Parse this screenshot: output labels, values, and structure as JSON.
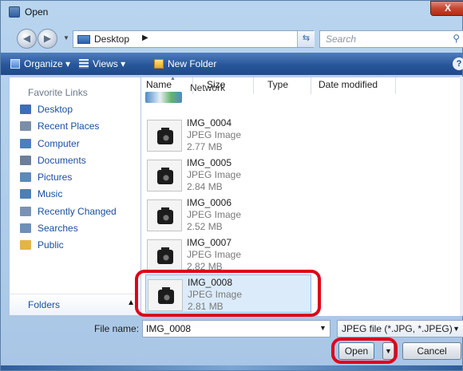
{
  "window": {
    "title": "Open",
    "close_label": "X"
  },
  "address": {
    "location": "Desktop",
    "search_placeholder": "Search"
  },
  "toolbar": {
    "organize": "Organize",
    "views": "Views",
    "new_folder": "New Folder",
    "help": "?"
  },
  "sidebar": {
    "heading": "Favorite Links",
    "items": [
      {
        "label": "Desktop",
        "icon": "desktop-icon",
        "color": "#3d6eb7"
      },
      {
        "label": "Recent Places",
        "icon": "recent-places-icon",
        "color": "#7b8ea8"
      },
      {
        "label": "Computer",
        "icon": "computer-icon",
        "color": "#4a7fc4"
      },
      {
        "label": "Documents",
        "icon": "documents-icon",
        "color": "#6c7f99"
      },
      {
        "label": "Pictures",
        "icon": "pictures-icon",
        "color": "#5d89b8"
      },
      {
        "label": "Music",
        "icon": "music-icon",
        "color": "#4f7fb7"
      },
      {
        "label": "Recently Changed",
        "icon": "recently-changed-icon",
        "color": "#7a93b4"
      },
      {
        "label": "Searches",
        "icon": "searches-icon",
        "color": "#6f8fb8"
      },
      {
        "label": "Public",
        "icon": "public-folder-icon",
        "color": "#e3b44a"
      }
    ],
    "folders_label": "Folders"
  },
  "columns": [
    "Name",
    "Size",
    "Type",
    "Date modified"
  ],
  "files": [
    {
      "name": "Network",
      "partial": true
    },
    {
      "name": "IMG_0004",
      "type": "JPEG Image",
      "size": "2.77 MB"
    },
    {
      "name": "IMG_0005",
      "type": "JPEG Image",
      "size": "2.84 MB"
    },
    {
      "name": "IMG_0006",
      "type": "JPEG Image",
      "size": "2.52 MB"
    },
    {
      "name": "IMG_0007",
      "type": "JPEG Image",
      "size": "2.82 MB"
    },
    {
      "name": "IMG_0008",
      "type": "JPEG Image",
      "size": "2.81 MB",
      "selected": true
    }
  ],
  "bottom": {
    "filename_label": "File name:",
    "filename_value": "IMG_0008",
    "filetype": "JPEG file (*.JPG, *.JPEG)",
    "open_label": "Open",
    "cancel_label": "Cancel"
  },
  "colors": {
    "highlight": "#e0001a",
    "toolbar": "#28569a",
    "link": "#1a4fa0"
  }
}
